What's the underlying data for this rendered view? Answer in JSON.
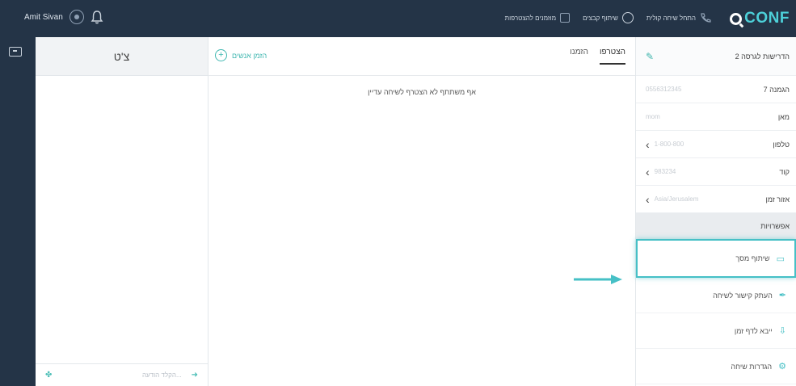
{
  "topbar": {
    "user_name": "Amit Sivan",
    "actions": [
      "מוזמנים להצטרפות",
      "שיתוף קבצים",
      "התחל שיחה קולית"
    ],
    "logo_text": "CONF"
  },
  "chat": {
    "title": "צ'ט",
    "input_placeholder": "הקלד הודעה..."
  },
  "main": {
    "invite_label": "הזמן אנשים",
    "tabs": [
      "הזמנו",
      "הצטרפו"
    ],
    "active_tab": "הצטרפו",
    "empty_message": "אף משתתף לא הצטרף לשיחה עדיין"
  },
  "settings": {
    "header": "הדרישות לגרסה 2",
    "rows": [
      {
        "label": "הגמנה 7",
        "value": "0556312345"
      },
      {
        "label": "מאן",
        "value": "mom"
      },
      {
        "label": "טלפון",
        "value": "1-800-800"
      },
      {
        "label": "קוד",
        "value": "983234"
      },
      {
        "label": "אזור זמן",
        "value": "Asia/Jerusalem"
      }
    ],
    "options_header": "אפשרויות",
    "options": [
      "שיתוף מסך",
      "העתק קישור לשיחה",
      "ייבא לדף זמן",
      "הגדרות שיחה"
    ],
    "highlighted_option": "שיתוף מסך"
  },
  "colors": {
    "topbar": "#243447",
    "accent": "#46c0c6",
    "logo": "#4dd0d9"
  }
}
